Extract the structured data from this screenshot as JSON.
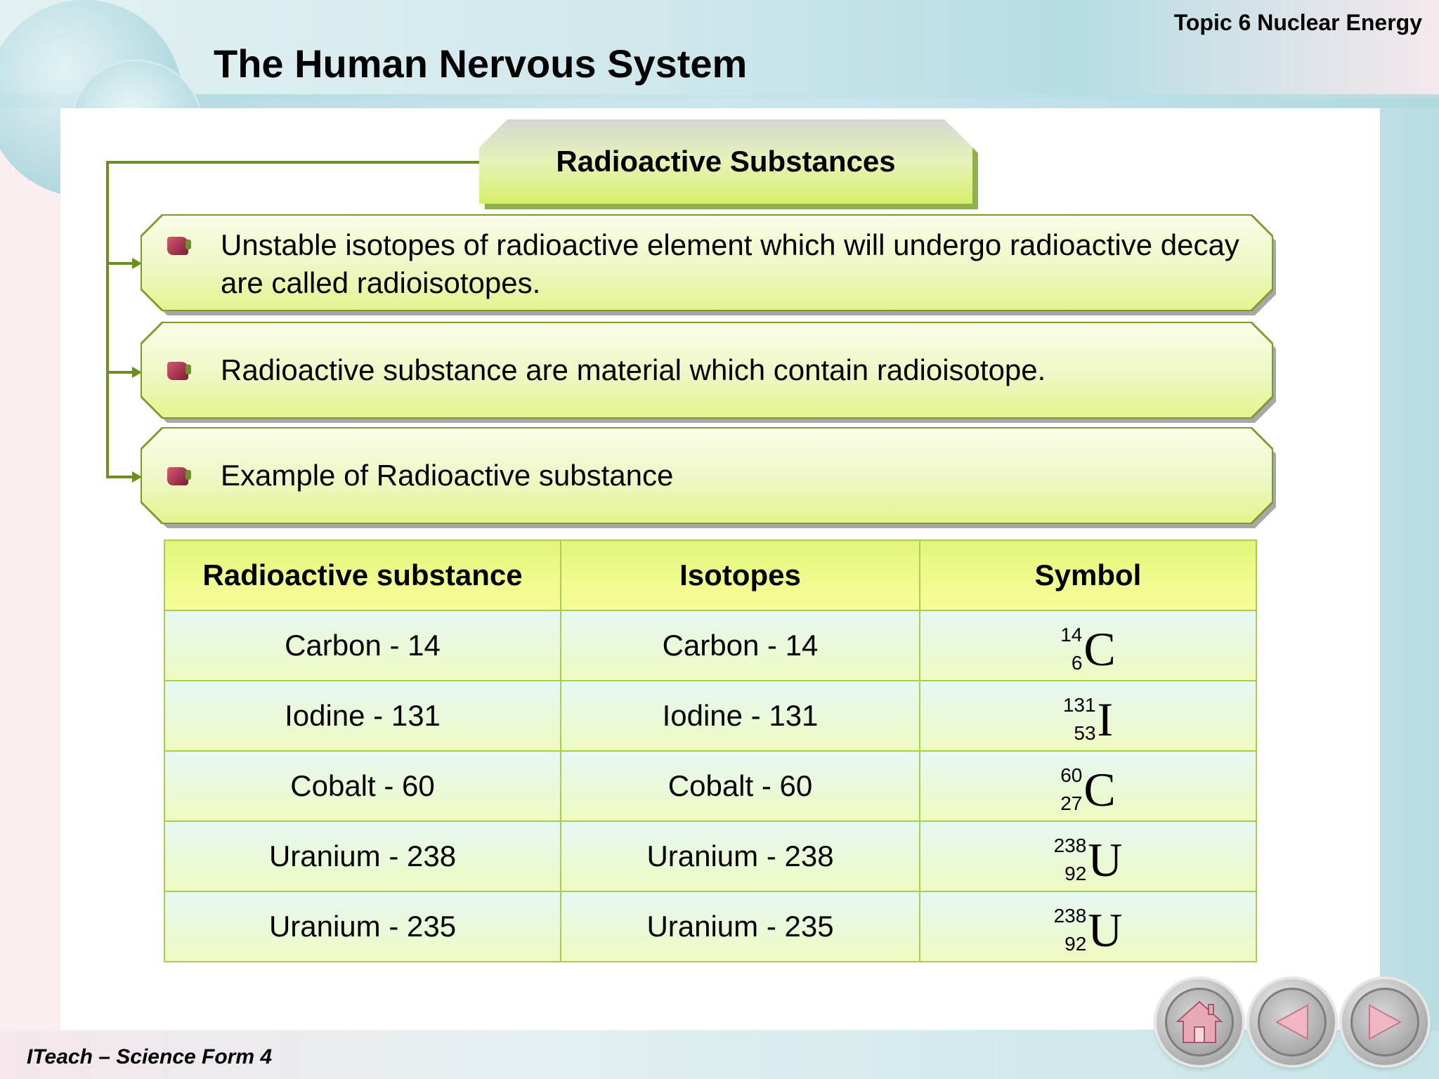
{
  "header": {
    "topic": "Topic 6 Nuclear Energy",
    "title": "The Human Nervous System"
  },
  "heading": {
    "label": "Radioactive Substances"
  },
  "bullets": [
    {
      "text": "Unstable isotopes of radioactive element which will undergo radioactive decay are called radioisotopes."
    },
    {
      "text": "Radioactive substance are material which contain radioisotope."
    },
    {
      "text": "Example of Radioactive substance"
    }
  ],
  "table": {
    "headers": [
      "Radioactive substance",
      "Isotopes",
      "Symbol"
    ],
    "rows": [
      {
        "substance": "Carbon - 14",
        "isotope": "Carbon - 14",
        "mass": "14",
        "atomic": "6",
        "symbol": "C"
      },
      {
        "substance": "Iodine - 131",
        "isotope": "Iodine - 131",
        "mass": "131",
        "atomic": "53",
        "symbol": "I"
      },
      {
        "substance": "Cobalt - 60",
        "isotope": "Cobalt - 60",
        "mass": "60",
        "atomic": "27",
        "symbol": "C"
      },
      {
        "substance": "Uranium - 238",
        "isotope": "Uranium - 238",
        "mass": "238",
        "atomic": "92",
        "symbol": "U"
      },
      {
        "substance": "Uranium - 235",
        "isotope": "Uranium - 235",
        "mass": "238",
        "atomic": "92",
        "symbol": "U"
      }
    ]
  },
  "footer": {
    "text": "ITeach – Science Form 4"
  },
  "nav": {
    "buttons": [
      "home-icon",
      "previous-arrow-icon",
      "next-arrow-icon"
    ]
  },
  "colors": {
    "connector": "#6b8e1e",
    "header_cell": "#e8f77f",
    "table_border": "#a7cf4a",
    "bullet_box": "#eef7c4"
  }
}
